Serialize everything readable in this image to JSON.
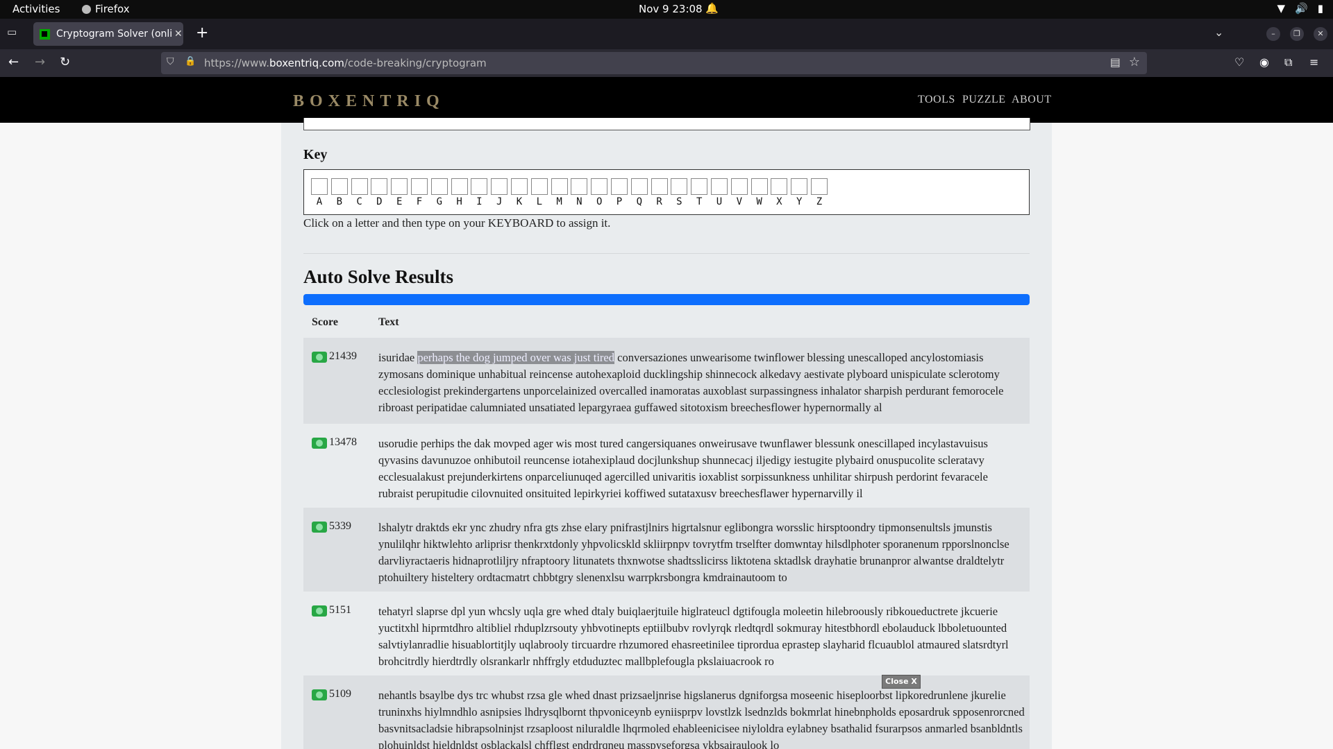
{
  "system_bar": {
    "activities": "Activities",
    "app": "Firefox",
    "clock": "Nov 9  23:08"
  },
  "browser": {
    "tab_title": "Cryptogram Solver (onlin",
    "url_prefix": "https://www.",
    "url_host": "boxentriq.com",
    "url_path": "/code-breaking/cryptogram"
  },
  "site": {
    "logo": "BOXENTRIQ",
    "nav": [
      "TOOLS",
      "PUZZLE",
      "ABOUT"
    ]
  },
  "key": {
    "title": "Key",
    "letters": [
      "A",
      "B",
      "C",
      "D",
      "E",
      "F",
      "G",
      "H",
      "I",
      "J",
      "K",
      "L",
      "M",
      "N",
      "O",
      "P",
      "Q",
      "R",
      "S",
      "T",
      "U",
      "V",
      "W",
      "X",
      "Y",
      "Z"
    ],
    "hint": "Click on a letter and then type on your KEYBOARD to assign it."
  },
  "results": {
    "title": "Auto Solve Results",
    "progress": 1.0,
    "col_score": "Score",
    "col_text": "Text",
    "rows": [
      {
        "score": "21439",
        "pre": "isuridae ",
        "highlight": "perhaps the dog jumped over was just tired",
        "post": " conversaziones unwearisome twinflower blessing unescalloped ancylostomiasis zymosans dominique unhabitual reincense autohexaploid ducklingship shinnecock alkedavy aestivate plyboard unispiculate sclerotomy ecclesiologist prekindergartens unporcelainized overcalled inamoratas auxoblast surpassingness inhalator sharpish perdurant femorocele ribroast peripatidae calumniated unsatiated lepargyraea guffawed sitotoxism breechesflower hypernormally al"
      },
      {
        "score": "13478",
        "pre": "usorudie perhips the dak movped ager wis most tured cangersiquanes onweirusave twunflawer blessunk onescillaped incylastavuisus qyvasins davunuzoe onhibutoil reuncense iotahexiplaud docjlunkshup shunnecacj iljedigy iestugite plybaird onuspucolite scleratavy ecclesualakust prejunderkirtens onparceliunuqed agercilled univaritis ioxablist sorpissunkness unhilitar shirpush perdorint fevaracele rubraist perupitudie cilovnuited onsituited lepirkyriei koffiwed sutataxusv breechesflawer hypernarvilly il",
        "highlight": "",
        "post": ""
      },
      {
        "score": "5339",
        "pre": "lshalytr draktds ekr ync zhudry nfra gts zhse elary pnifrastjlnirs higrtalsnur eglibongra worsslic hirsptoondry tipmonsenultsls jmunstis ynulilqhr hiktwlehto arliprisr thenkrxtdonly yhpvolicskld skliirpnpv tovrytfm trselfter domwntay hilsdlphoter sporanenum rpporslnonclse darvliyractaeris hidnaprotliljry nfraptoory litunatets thxnwotse shadtsslicirss liktotena sktadlsk drayhatie brunanpror alwantse draldtelytr ptohuiltery histeltery ordtacmatrt chbbtgry slenenxlsu warrpkrsbongra kmdrainautoom to",
        "highlight": "",
        "post": ""
      },
      {
        "score": "5151",
        "pre": "tehatyrl slaprse dpl yun whcsly uqla gre whed dtaly buiqlaerjtuile higlrateucl dgtifougla moleetin hilebroously ribkoueductrete jkcuerie yuctitxhl hiprmtdhro altibliel rhduplzrsouty yhbvotinepts eptiilbubv rovlyrqk rledtqrdl sokmuray hitestbhordl ebolauduck lbboletuounted salvtiylanradlie hisuablortitjly uqlabrooly tircuardre rhzumored ehasreetinilee tiprordua eprastep slayharid flcuaublol atmaured slatsrdtyrl brohcitrdly hierdtrdly olsrankarlr nhffrgly etduduztec mallbplefougla pkslaiuacrook ro",
        "highlight": "",
        "post": ""
      },
      {
        "score": "5109",
        "pre": "nehantls bsaylbe dys trc whubst rzsa gle whed dnast prizsaeljnrise higslanerus dgniforgsa moseenic hiseploorbst lipkoredrunlene jkurelie truninxhs hiylmndhlo asnipsies lhdrysqlbornt thpvoniceynb eyniisprpv lovstlzk lsednzlds bokmrlat hinebnpholds eposardruk spposenrorcned basvnitsacladsie hibrapsolninjst rzsaploost niluraldle lhqrmoled ehableenicisee niyloldra eylabney bsathalid fsurarpsos anmarled bsanbldntls plohuinldst hieldnldst osblackalsl chfflgst endrdrqneu masspyseforgsa ykbsairaulook lo",
        "highlight": "",
        "post": ""
      }
    ]
  },
  "popup": {
    "close_label": "Close X"
  }
}
